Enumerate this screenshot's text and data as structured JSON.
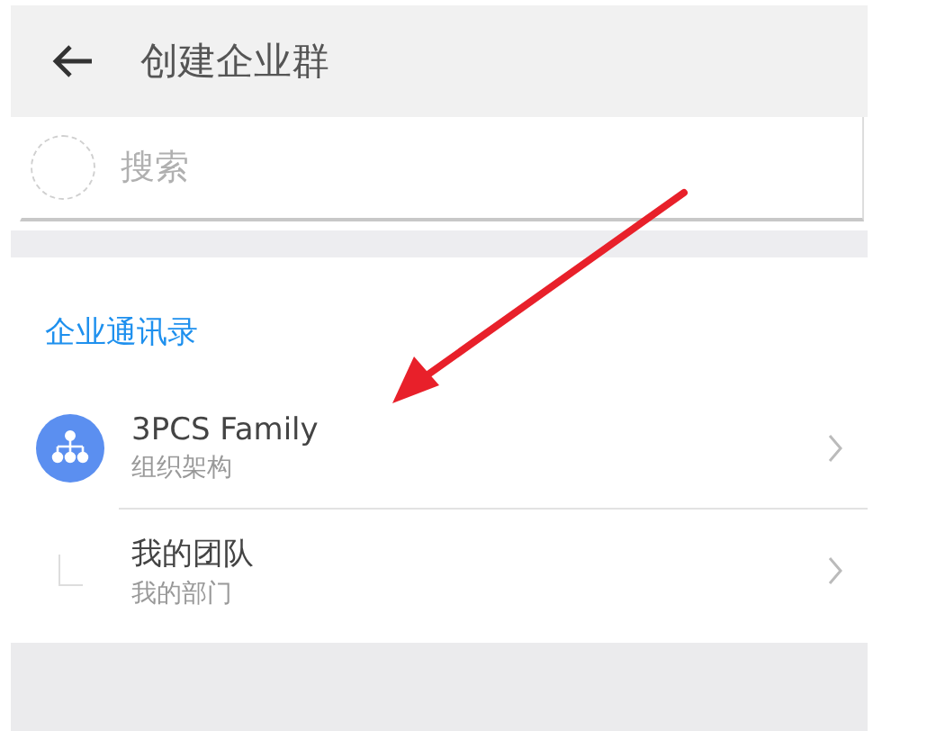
{
  "header": {
    "title": "创建企业群"
  },
  "search": {
    "placeholder": "搜索"
  },
  "section": {
    "title": "企业通讯录"
  },
  "items": [
    {
      "kind": "org",
      "title": "3PCS Family",
      "subtitle": "组织架构"
    },
    {
      "kind": "team",
      "title": "我的团队",
      "subtitle": "我的部门"
    }
  ]
}
